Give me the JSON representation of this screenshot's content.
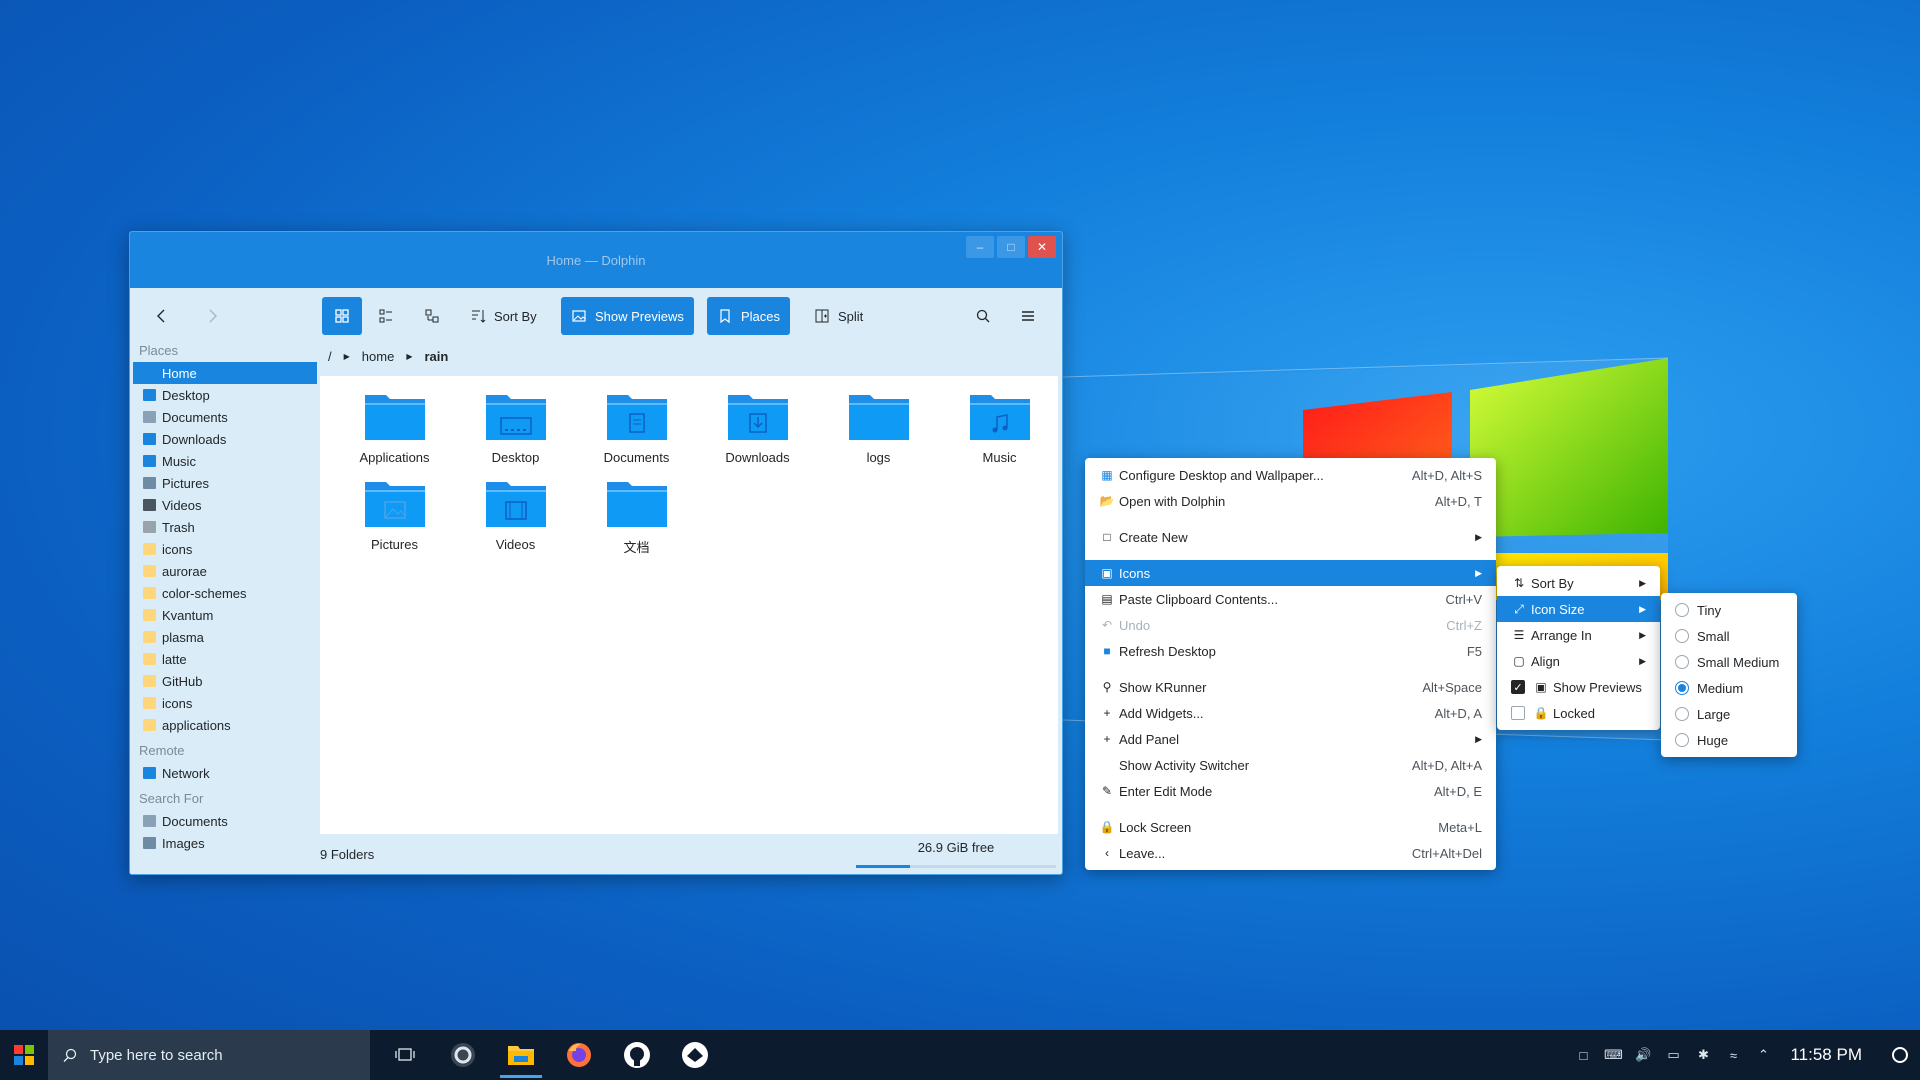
{
  "window": {
    "title": "Home — Dolphin",
    "controls": [
      "minimize",
      "maximize",
      "close"
    ]
  },
  "toolbar": {
    "back": "back",
    "forward": "forward",
    "sort_by": "Sort By",
    "show_previews": "Show Previews",
    "places": "Places",
    "split": "Split"
  },
  "sidebar": {
    "places_title": "Places",
    "places": [
      {
        "label": "Home",
        "icon": "home-icon",
        "color": "#1a85df"
      },
      {
        "label": "Desktop",
        "icon": "desktop-icon",
        "color": "#1a85df"
      },
      {
        "label": "Documents",
        "icon": "documents-icon",
        "color": "#8aa0b4"
      },
      {
        "label": "Downloads",
        "icon": "downloads-icon",
        "color": "#1a85df"
      },
      {
        "label": "Music",
        "icon": "music-icon",
        "color": "#1a85df"
      },
      {
        "label": "Pictures",
        "icon": "pictures-icon",
        "color": "#6f8aa3"
      },
      {
        "label": "Videos",
        "icon": "videos-icon",
        "color": "#4b5561"
      },
      {
        "label": "Trash",
        "icon": "trash-icon",
        "color": "#9aa3ab"
      },
      {
        "label": "icons",
        "icon": "folder-icon",
        "color": "#ffd77a"
      },
      {
        "label": "aurorae",
        "icon": "folder-icon",
        "color": "#ffd77a"
      },
      {
        "label": "color-schemes",
        "icon": "folder-icon",
        "color": "#ffd77a"
      },
      {
        "label": "Kvantum",
        "icon": "folder-icon",
        "color": "#ffd77a"
      },
      {
        "label": "plasma",
        "icon": "folder-icon",
        "color": "#ffd77a"
      },
      {
        "label": "latte",
        "icon": "folder-icon",
        "color": "#ffd77a"
      },
      {
        "label": "GitHub",
        "icon": "folder-icon",
        "color": "#ffd77a"
      },
      {
        "label": "icons",
        "icon": "folder-icon",
        "color": "#ffd77a"
      },
      {
        "label": "applications",
        "icon": "folder-icon",
        "color": "#ffd77a"
      }
    ],
    "remote_title": "Remote",
    "remote": [
      {
        "label": "Network",
        "icon": "network-icon",
        "color": "#1a85df"
      }
    ],
    "search_title": "Search For",
    "search": [
      {
        "label": "Documents",
        "icon": "documents-icon",
        "color": "#8aa0b4"
      },
      {
        "label": "Images",
        "icon": "images-icon",
        "color": "#6f8aa3"
      }
    ]
  },
  "breadcrumb": {
    "root": "/",
    "parts": [
      "home",
      "rain"
    ]
  },
  "files": [
    {
      "name": "Applications",
      "glyph": ""
    },
    {
      "name": "Desktop",
      "glyph": "desktop"
    },
    {
      "name": "Documents",
      "glyph": "doc"
    },
    {
      "name": "Downloads",
      "glyph": "down"
    },
    {
      "name": "logs",
      "glyph": ""
    },
    {
      "name": "Music",
      "glyph": "music"
    },
    {
      "name": "Pictures",
      "glyph": "pic"
    },
    {
      "name": "Videos",
      "glyph": "video"
    },
    {
      "name": "文档",
      "glyph": ""
    }
  ],
  "status": {
    "count": "9 Folders",
    "free": "26.9 GiB free",
    "used_fraction": 0.27
  },
  "context_menu": {
    "items": [
      {
        "label": "Configure Desktop and Wallpaper...",
        "shortcut": "Alt+D, Alt+S",
        "icon": "configure-icon"
      },
      {
        "label": "Open with Dolphin",
        "shortcut": "Alt+D, T",
        "icon": "dolphin-icon"
      },
      {
        "sep": true
      },
      {
        "label": "Create New",
        "submenu": true,
        "icon": "create-new-icon"
      },
      {
        "sep": true
      },
      {
        "label": "Icons",
        "submenu": true,
        "highlight": true,
        "icon": "icons-icon"
      },
      {
        "label": "Paste Clipboard Contents...",
        "shortcut": "Ctrl+V",
        "icon": "paste-icon"
      },
      {
        "label": "Undo",
        "shortcut": "Ctrl+Z",
        "disabled": true,
        "icon": "undo-icon"
      },
      {
        "label": "Refresh Desktop",
        "shortcut": "F5",
        "icon": "refresh-icon"
      },
      {
        "sep": true
      },
      {
        "label": "Show KRunner",
        "shortcut": "Alt+Space",
        "icon": "krunner-icon"
      },
      {
        "label": "Add Widgets...",
        "shortcut": "Alt+D, A",
        "icon": "add-icon"
      },
      {
        "label": "Add Panel",
        "submenu": true,
        "icon": "add-icon"
      },
      {
        "label": "Show Activity Switcher",
        "shortcut": "Alt+D, Alt+A",
        "icon": ""
      },
      {
        "label": "Enter Edit Mode",
        "shortcut": "Alt+D, E",
        "icon": "edit-icon"
      },
      {
        "sep": true
      },
      {
        "label": "Lock Screen",
        "shortcut": "Meta+L",
        "icon": "lock-icon"
      },
      {
        "label": "Leave...",
        "shortcut": "Ctrl+Alt+Del",
        "icon": "leave-icon"
      }
    ]
  },
  "icons_menu": {
    "items": [
      {
        "label": "Sort By",
        "submenu": true,
        "icon": "sort-icon"
      },
      {
        "label": "Icon Size",
        "submenu": true,
        "highlight": true,
        "icon": "icon-size-icon"
      },
      {
        "label": "Arrange In",
        "submenu": true,
        "icon": "arrange-icon"
      },
      {
        "label": "Align",
        "submenu": true,
        "icon": "align-icon"
      },
      {
        "label": "Show Previews",
        "checkbox": true,
        "checked": true,
        "icon": "previews-icon"
      },
      {
        "label": "Locked",
        "checkbox": true,
        "checked": false,
        "icon": "lock-icon"
      }
    ]
  },
  "size_menu": {
    "options": [
      "Tiny",
      "Small",
      "Small Medium",
      "Medium",
      "Large",
      "Huge"
    ],
    "selected": "Medium"
  },
  "taskbar": {
    "search_placeholder": "Type here to search",
    "apps": [
      "task-view-icon",
      "obs-icon",
      "file-manager-icon",
      "firefox-icon",
      "github-icon",
      "app-icon"
    ],
    "active_app": "file-manager-icon",
    "clock": "11:58 PM"
  }
}
